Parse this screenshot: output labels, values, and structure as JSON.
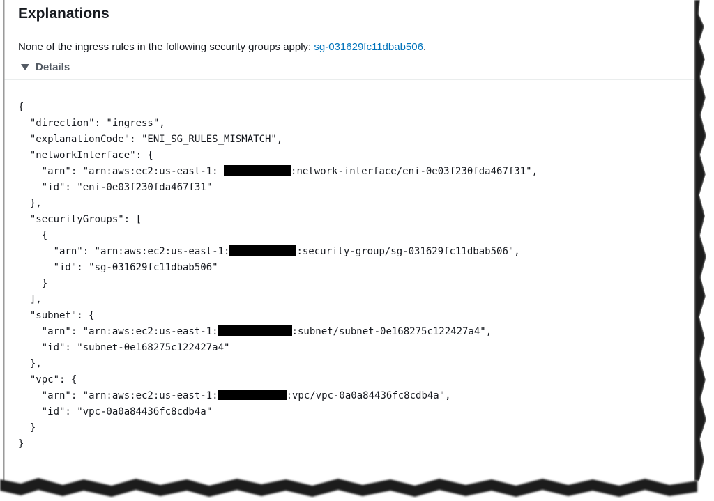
{
  "explanations": {
    "title": "Explanations",
    "summary_text": "None of the ingress rules in the following security groups apply: ",
    "summary_link": "sg-031629fc11dbab506",
    "summary_end": ".",
    "details_label": "Details"
  },
  "json_lines": [
    {
      "text": "{"
    },
    {
      "text": "  \"direction\": \"ingress\","
    },
    {
      "text": "  \"explanationCode\": \"ENI_SG_RULES_MISMATCH\","
    },
    {
      "text": "  \"networkInterface\": {"
    },
    {
      "prefix": "    \"arn\": \"arn:aws:ec2:us-east-1: ",
      "suffix": ":network-interface/eni-0e03f230fda467f31\",",
      "redacted": true
    },
    {
      "text": "    \"id\": \"eni-0e03f230fda467f31\""
    },
    {
      "text": "  },"
    },
    {
      "text": "  \"securityGroups\": ["
    },
    {
      "text": "    {"
    },
    {
      "prefix": "      \"arn\": \"arn:aws:ec2:us-east-1:",
      "suffix": ":security-group/sg-031629fc11dbab506\",",
      "redacted": true
    },
    {
      "text": "      \"id\": \"sg-031629fc11dbab506\""
    },
    {
      "text": "    }"
    },
    {
      "text": "  ],"
    },
    {
      "text": "  \"subnet\": {"
    },
    {
      "prefix": "    \"arn\": \"arn:aws:ec2:us-east-1:",
      "suffix": ":subnet/subnet-0e168275c122427a4\",",
      "redacted": true
    },
    {
      "text": "    \"id\": \"subnet-0e168275c122427a4\""
    },
    {
      "text": "  },"
    },
    {
      "text": "  \"vpc\": {"
    },
    {
      "prefix": "    \"arn\": \"arn:aws:ec2:us-east-1:",
      "suffix": ":vpc/vpc-0a0a84436fc8cdb4a\",",
      "redacted": true
    },
    {
      "text": "    \"id\": \"vpc-0a0a84436fc8cdb4a\""
    },
    {
      "text": "  }"
    },
    {
      "text": "}"
    }
  ],
  "colors": {
    "link": "#0073bb",
    "text": "#16191f",
    "muted": "#545b64",
    "redaction": "#000000"
  }
}
